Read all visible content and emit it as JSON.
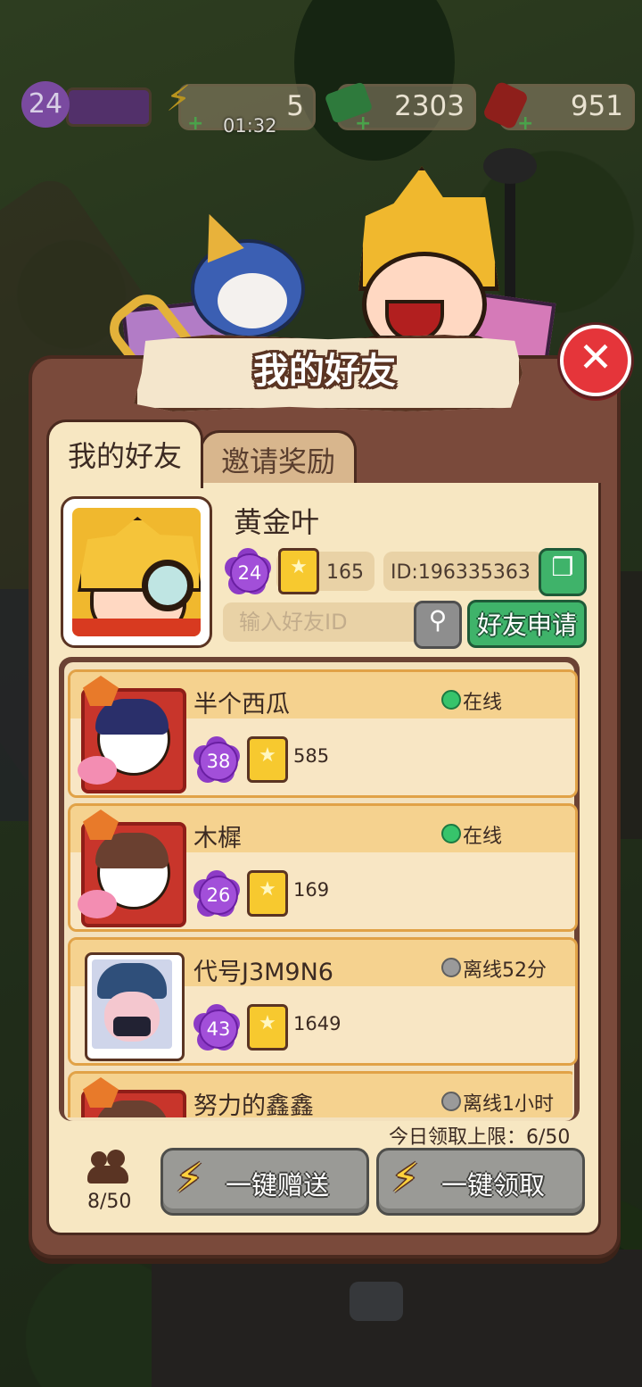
{
  "hud": {
    "level": "24",
    "energy": "5",
    "energy_timer": "01:32",
    "cash": "2303",
    "gems": "951"
  },
  "modal": {
    "title": "我的好友",
    "close_icon": "close-icon"
  },
  "tabs": [
    {
      "label": "我的好友",
      "active": true
    },
    {
      "label": "邀请奖励",
      "active": false
    }
  ],
  "profile": {
    "name": "黄金叶",
    "level": "24",
    "cards": "165",
    "id_text": "ID:196335363"
  },
  "search": {
    "placeholder": "输入好友ID",
    "apply_label": "好友申请"
  },
  "friends": [
    {
      "name": "半个西瓜",
      "level": "38",
      "cards": "585",
      "status": "在线",
      "online": true
    },
    {
      "name": "木樨",
      "level": "26",
      "cards": "169",
      "status": "在线",
      "online": true
    },
    {
      "name": "代号J3M9N6",
      "level": "43",
      "cards": "1649",
      "status": "离线52分",
      "online": false
    },
    {
      "name": "努力的鑫鑫",
      "level": "",
      "cards": "",
      "status": "离线1小时",
      "online": false
    }
  ],
  "footer": {
    "daily_limit": "今日领取上限：6/50",
    "friend_count": "8/50",
    "send_all_label": "一键赠送",
    "claim_all_label": "一键领取"
  },
  "colors": {
    "panel": "#7a4a3b",
    "paper": "#f7e7c2",
    "accent_green": "#3fb36a",
    "close_red": "#e5353a",
    "level_purple": "#a24fd9"
  }
}
